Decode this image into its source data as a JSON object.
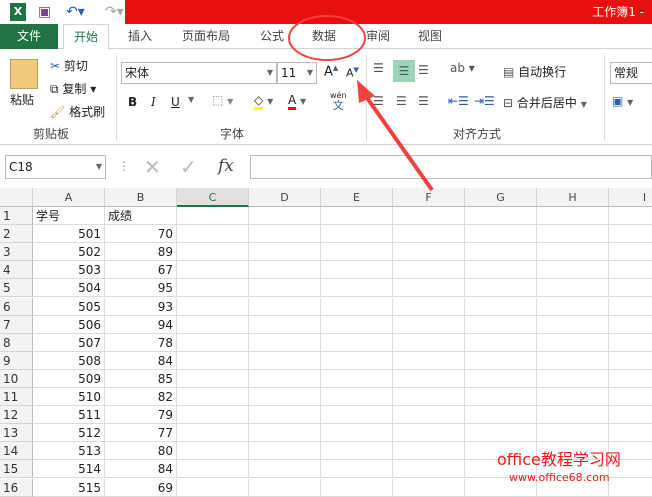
{
  "title": "工作簿1 -",
  "tabs": [
    "文件",
    "开始",
    "插入",
    "页面布局",
    "公式",
    "数据",
    "审阅",
    "视图"
  ],
  "ribbon": {
    "clipboard": {
      "paste": "粘贴",
      "cut": "剪切",
      "copy": "复制",
      "format_painter": "格式刷",
      "label": "剪贴板"
    },
    "font": {
      "name": "宋体",
      "size": "11",
      "bold": "B",
      "italic": "I",
      "underline": "U",
      "label": "字体",
      "phonetic": "wén"
    },
    "alignment": {
      "wrap": "自动换行",
      "merge": "合并后居中",
      "label": "对齐方式"
    },
    "number": {
      "format": "常规"
    }
  },
  "formula_bar": {
    "name_box": "C18",
    "fx": "fx",
    "value": ""
  },
  "columns": [
    "A",
    "B",
    "C",
    "D",
    "E",
    "F",
    "G",
    "H",
    "I"
  ],
  "rows": [
    [
      "学号",
      "成绩"
    ],
    [
      "501",
      "70"
    ],
    [
      "502",
      "89"
    ],
    [
      "503",
      "67"
    ],
    [
      "504",
      "95"
    ],
    [
      "505",
      "93"
    ],
    [
      "506",
      "94"
    ],
    [
      "507",
      "78"
    ],
    [
      "508",
      "84"
    ],
    [
      "509",
      "85"
    ],
    [
      "510",
      "82"
    ],
    [
      "511",
      "79"
    ],
    [
      "512",
      "77"
    ],
    [
      "513",
      "80"
    ],
    [
      "514",
      "84"
    ],
    [
      "515",
      "69"
    ]
  ],
  "watermark": {
    "line1": "office教程学习网",
    "line2": "www.office68.com"
  },
  "colors": {
    "title_red": "#e81010",
    "excel_green": "#217346",
    "annotation": "#f04040"
  }
}
